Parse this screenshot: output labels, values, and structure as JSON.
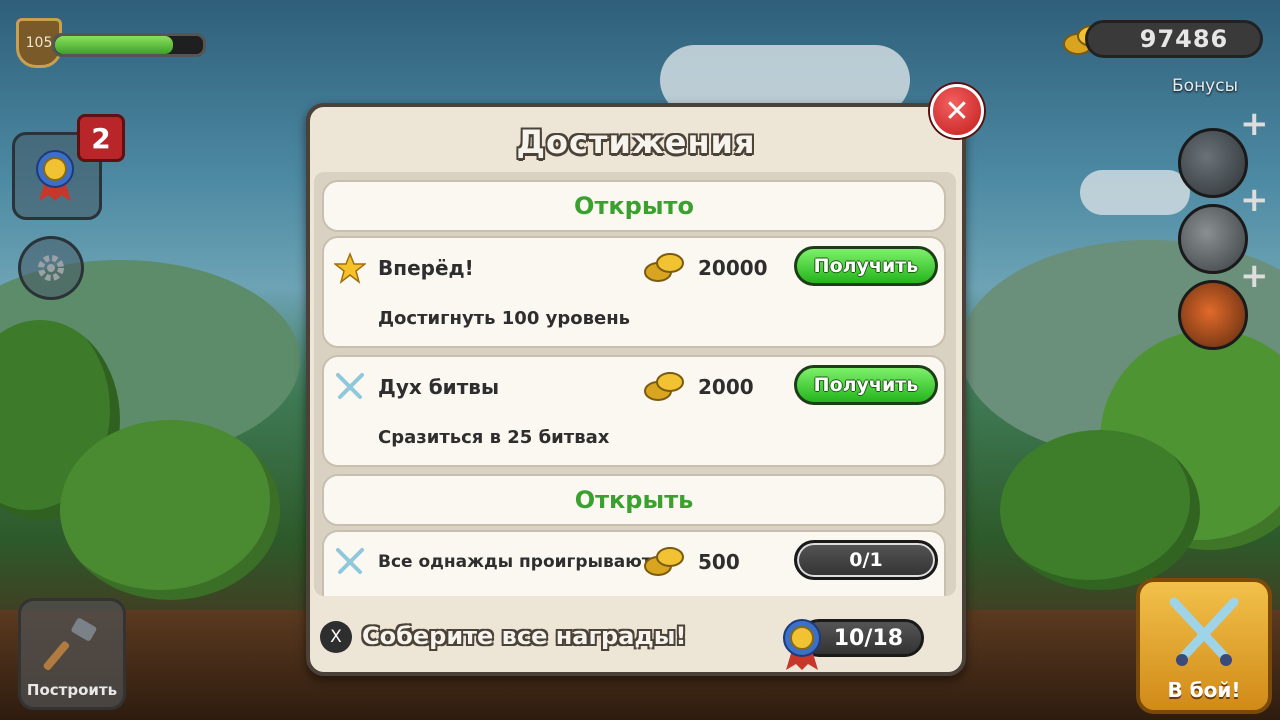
{
  "hud": {
    "level": "105",
    "xp_progress": 0.8,
    "coins": "97486",
    "bonuses_label": "Бонусы",
    "achievements_badge_count": "2"
  },
  "buttons": {
    "build_label": "Построить",
    "fight_label": "В бой!"
  },
  "dialog": {
    "title": "Достижения",
    "sections": {
      "opened_label": "Открыто",
      "to_open_label": "Открыть"
    },
    "achievements": [
      {
        "icon": "star-icon",
        "name": "Вперёд!",
        "reward": "20000",
        "description": "Достигнуть 100 уровень",
        "action_label": "Получить"
      },
      {
        "icon": "crossed-swords-icon",
        "name": "Дух битвы",
        "reward": "2000",
        "description": "Сразиться в 25 битвах",
        "action_label": "Получить"
      },
      {
        "icon": "crossed-swords-icon",
        "name": "Все однажды проигрывают",
        "reward": "500",
        "progress": "0/1"
      }
    ],
    "footer": {
      "x_label": "X",
      "text": "Соберите все награды!",
      "progress": "10/18"
    }
  },
  "colors": {
    "accent_green": "#3aa02e",
    "claim_button": "#24b51c",
    "close_button": "#c21c1c",
    "panel": "#ede6d6"
  }
}
